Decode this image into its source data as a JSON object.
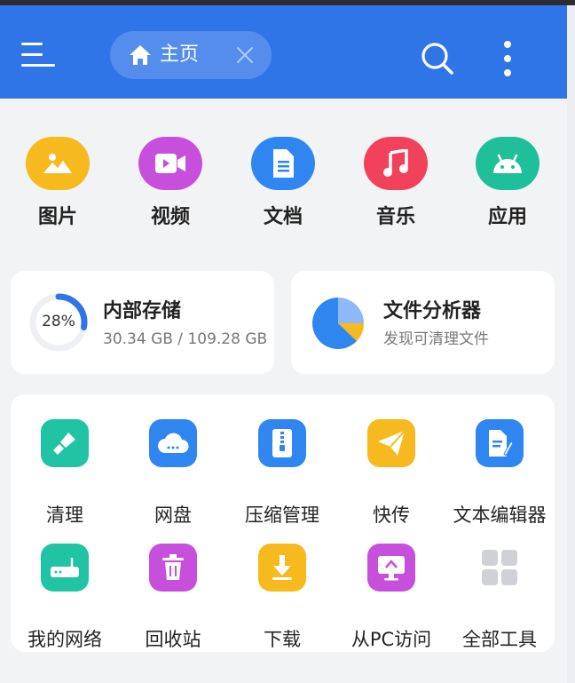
{
  "header": {
    "tab_label": "主页",
    "accent_color": "#2f75e8"
  },
  "categories": [
    {
      "label": "图片",
      "icon": "image-icon",
      "color": "#f6b91e"
    },
    {
      "label": "视频",
      "icon": "video-icon",
      "color": "#c64fdb"
    },
    {
      "label": "文档",
      "icon": "document-icon",
      "color": "#2f86f0"
    },
    {
      "label": "音乐",
      "icon": "music-icon",
      "color": "#f2415a"
    },
    {
      "label": "应用",
      "icon": "android-icon",
      "color": "#1fbf9a"
    }
  ],
  "storage": {
    "title": "内部存储",
    "used_text": "30.34 GB / 109.28 GB",
    "percent_text": "28%",
    "percent": 0.28
  },
  "analyzer": {
    "title": "文件分析器",
    "subtitle": "发现可清理文件"
  },
  "tools": [
    {
      "label": "清理",
      "icon": "broom-icon",
      "color": "#20c3a3"
    },
    {
      "label": "网盘",
      "icon": "cloud-icon",
      "color": "#2f86f0"
    },
    {
      "label": "压缩管理",
      "icon": "zip-icon",
      "color": "#2f86f0"
    },
    {
      "label": "快传",
      "icon": "paper-plane-icon",
      "color": "#f6b91e"
    },
    {
      "label": "文本编辑器",
      "icon": "text-edit-icon",
      "color": "#2f86f0"
    },
    {
      "label": "我的网络",
      "icon": "router-icon",
      "color": "#20c3a3"
    },
    {
      "label": "回收站",
      "icon": "trash-icon",
      "color": "#c64fdb"
    },
    {
      "label": "下载",
      "icon": "download-icon",
      "color": "#f6b91e"
    },
    {
      "label": "从PC访问",
      "icon": "pc-access-icon",
      "color": "#c64fdb"
    },
    {
      "label": "全部工具",
      "icon": "grid-icon",
      "color": "#c9cbd0"
    }
  ]
}
